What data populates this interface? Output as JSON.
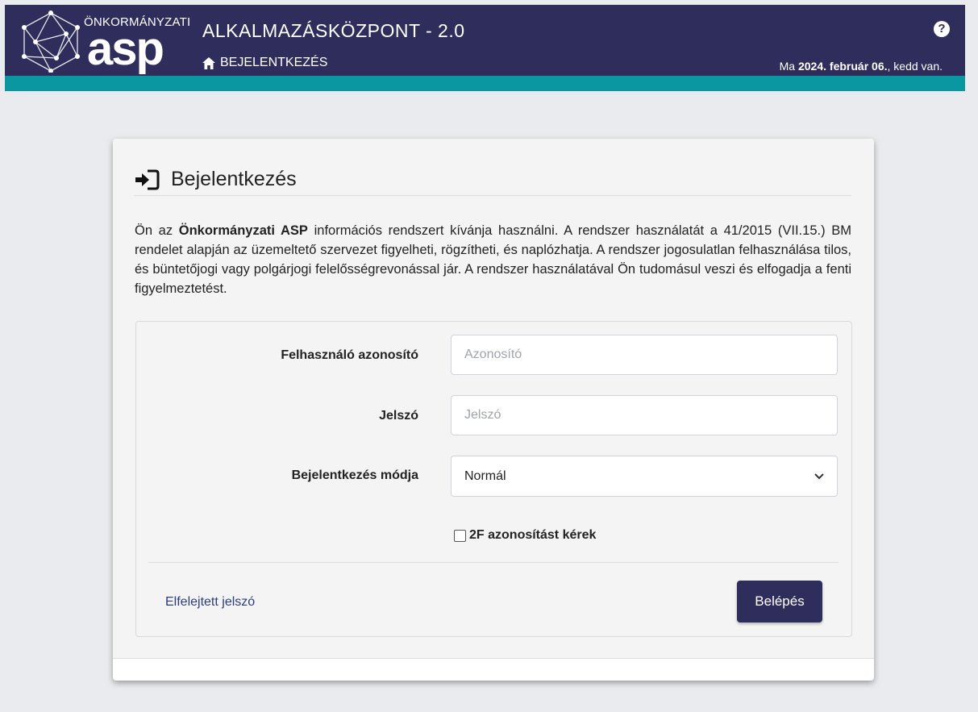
{
  "header": {
    "logo_top": "ÖNKORMÁNYZATI",
    "logo_main": "asp",
    "app_title": "ALKALMAZÁSKÖZPONT - 2.0",
    "breadcrumb": "BEJELENTKEZÉS",
    "help_glyph": "?",
    "date_prefix": "Ma ",
    "date_value": "2024. február 06.",
    "date_suffix": ", kedd van.",
    "colors": {
      "header_bg": "#2f2d5b",
      "accent_bar": "#0b97a2"
    }
  },
  "login": {
    "title": "Bejelentkezés",
    "intro_1": "Ön az ",
    "intro_bold": "Önkormányzati ASP",
    "intro_2": " információs rendszert kívánja használni. A rendszer használatát a 41/2015 (VII.15.) BM rendelet alapján az üzemeltető szervezet figyelheti, rögzítheti, és naplózhatja. A rendszer jogosulatlan felhasználása tilos, és büntetőjogi vagy polgárjogi felelősségrevonással jár. A rendszer használatával Ön tudomásul veszi és elfogadja a fenti figyelmeztetést.",
    "username_label": "Felhasználó azonosító",
    "username_placeholder": "Azonosító",
    "username_value": "",
    "password_label": "Jelszó",
    "password_placeholder": "Jelszó",
    "password_value": "",
    "mode_label": "Bejelentkezés módja",
    "mode_selected": "Normál",
    "twofa_label": "2F azonosítást kérek",
    "twofa_checked": false,
    "forgot_label": "Elfelejtett jelszó",
    "submit_label": "Belépés"
  },
  "icons": [
    "home-icon",
    "help-icon",
    "login-icon",
    "chevron-down-icon"
  ]
}
